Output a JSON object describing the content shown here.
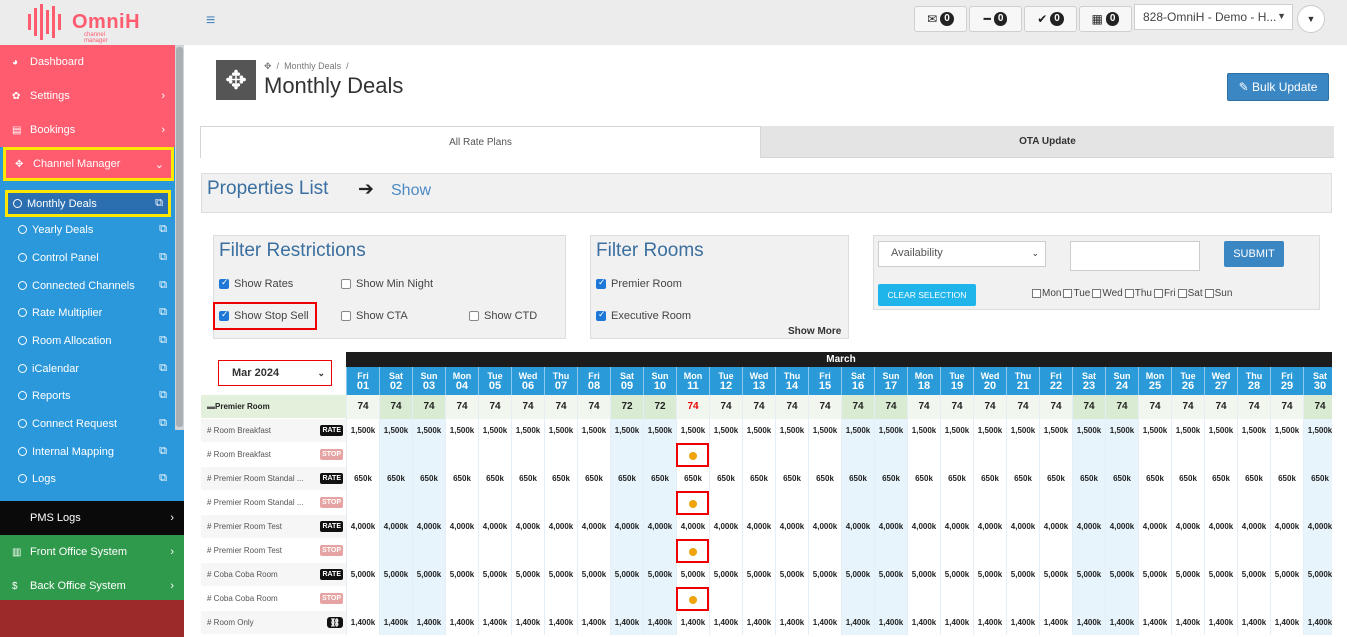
{
  "topbar": {
    "brand": "OmniH",
    "brand_sub": "channel manager",
    "counters": [
      {
        "icon": "envelope-icon",
        "glyph": "✉",
        "count": "0"
      },
      {
        "icon": "minus-icon",
        "glyph": "━",
        "count": "0"
      },
      {
        "icon": "check-icon",
        "glyph": "✔",
        "count": "0"
      },
      {
        "icon": "calendar-icon",
        "glyph": "▦",
        "count": "0"
      }
    ],
    "property": "828-OmniH - Demo - H..."
  },
  "sidebar": {
    "dashboard": "Dashboard",
    "settings": "Settings",
    "bookings": "Bookings",
    "channel_manager": "Channel Manager",
    "sub": [
      "Monthly Deals",
      "Yearly Deals",
      "Control Panel",
      "Connected Channels",
      "Rate Multiplier",
      "Room Allocation",
      "iCalendar",
      "Reports",
      "Connect Request",
      "Internal Mapping",
      "Logs"
    ],
    "pms_logs": "PMS Logs",
    "front_office": "Front Office System",
    "back_office": "Back Office System"
  },
  "page": {
    "breadcrumb": "Monthly Deals",
    "title": "Monthly Deals",
    "bulk_update": "Bulk Update",
    "tab_all_rate_plans": "All Rate Plans",
    "tab_ota_update": "OTA Update",
    "properties_list": "Properties List",
    "show": "Show"
  },
  "filters": {
    "restrictions_title": "Filter Restrictions",
    "show_rates": "Show Rates",
    "show_min_night": "Show Min Night",
    "show_stop_sell": "Show Stop Sell",
    "show_cta": "Show CTA",
    "show_ctd": "Show CTD",
    "rooms_title": "Filter Rooms",
    "premier_room": "Premier Room",
    "executive_room": "Executive Room",
    "show_more": "Show More",
    "availability": "Availability",
    "submit": "SUBMIT",
    "clear_selection": "CLEAR SELECTION",
    "days": [
      "Mon",
      "Tue",
      "Wed",
      "Thu",
      "Fri",
      "Sat",
      "Sun"
    ]
  },
  "grid": {
    "month_select": "Mar 2024",
    "month": "March",
    "days": [
      [
        "Fri",
        "01"
      ],
      [
        "Sat",
        "02"
      ],
      [
        "Sun",
        "03"
      ],
      [
        "Mon",
        "04"
      ],
      [
        "Tue",
        "05"
      ],
      [
        "Wed",
        "06"
      ],
      [
        "Thu",
        "07"
      ],
      [
        "Fri",
        "08"
      ],
      [
        "Sat",
        "09"
      ],
      [
        "Sun",
        "10"
      ],
      [
        "Mon",
        "11"
      ],
      [
        "Tue",
        "12"
      ],
      [
        "Wed",
        "13"
      ],
      [
        "Thu",
        "14"
      ],
      [
        "Fri",
        "15"
      ],
      [
        "Sat",
        "16"
      ],
      [
        "Sun",
        "17"
      ],
      [
        "Mon",
        "18"
      ],
      [
        "Tue",
        "19"
      ],
      [
        "Wed",
        "20"
      ],
      [
        "Thu",
        "21"
      ],
      [
        "Fri",
        "22"
      ],
      [
        "Sat",
        "23"
      ],
      [
        "Sun",
        "24"
      ],
      [
        "Mon",
        "25"
      ],
      [
        "Tue",
        "26"
      ],
      [
        "Wed",
        "27"
      ],
      [
        "Thu",
        "28"
      ],
      [
        "Fri",
        "29"
      ],
      [
        "Sat",
        "30"
      ]
    ],
    "room_name": "Premier Room",
    "availability": [
      "74",
      "74",
      "74",
      "74",
      "74",
      "74",
      "74",
      "74",
      "72",
      "72",
      "74",
      "74",
      "74",
      "74",
      "74",
      "74",
      "74",
      "74",
      "74",
      "74",
      "74",
      "74",
      "74",
      "74",
      "74",
      "74",
      "74",
      "74",
      "74",
      "74"
    ],
    "highlight_day_index": 10,
    "rows": [
      {
        "label": "# Room Breakfast",
        "tag": "RATE",
        "value": "1,500k"
      },
      {
        "label": "# Room Breakfast",
        "tag": "STOP",
        "value": ""
      },
      {
        "label": "# Premier Room Standal ...",
        "tag": "RATE",
        "value": "650k"
      },
      {
        "label": "# Premier Room Standal ...",
        "tag": "STOP",
        "value": ""
      },
      {
        "label": "# Premier Room Test",
        "tag": "RATE",
        "value": "4,000k"
      },
      {
        "label": "# Premier Room Test",
        "tag": "STOP",
        "value": ""
      },
      {
        "label": "# Coba Coba Room",
        "tag": "RATE",
        "value": "5,000k"
      },
      {
        "label": "# Coba Coba Room",
        "tag": "STOP",
        "value": ""
      },
      {
        "label": "# Room Only",
        "tag": "LINK",
        "value": "1,400k"
      }
    ]
  }
}
